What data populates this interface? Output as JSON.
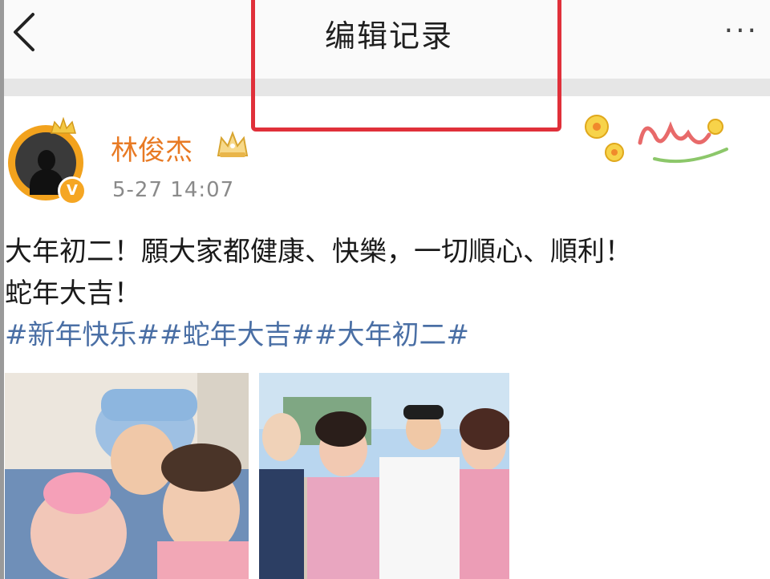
{
  "header": {
    "title": "编辑记录",
    "back_icon": "chevron-left-icon",
    "more_icon": "more-dots-icon",
    "more_label": "···"
  },
  "post": {
    "author": "林俊杰",
    "timestamp": "5-27 14:07",
    "verified_badge": "V",
    "text_line1": "大年初二！願大家都健康、快樂，一切順心、順利！",
    "text_line2": "蛇年大吉！",
    "hashtags": [
      "#新年快乐#",
      "#蛇年大吉#",
      "#大年初二#"
    ]
  },
  "colors": {
    "username": "#e87a24",
    "hashtag": "#4a6fa5",
    "highlight_box": "#e0303a",
    "verified_badge": "#f5a623"
  }
}
